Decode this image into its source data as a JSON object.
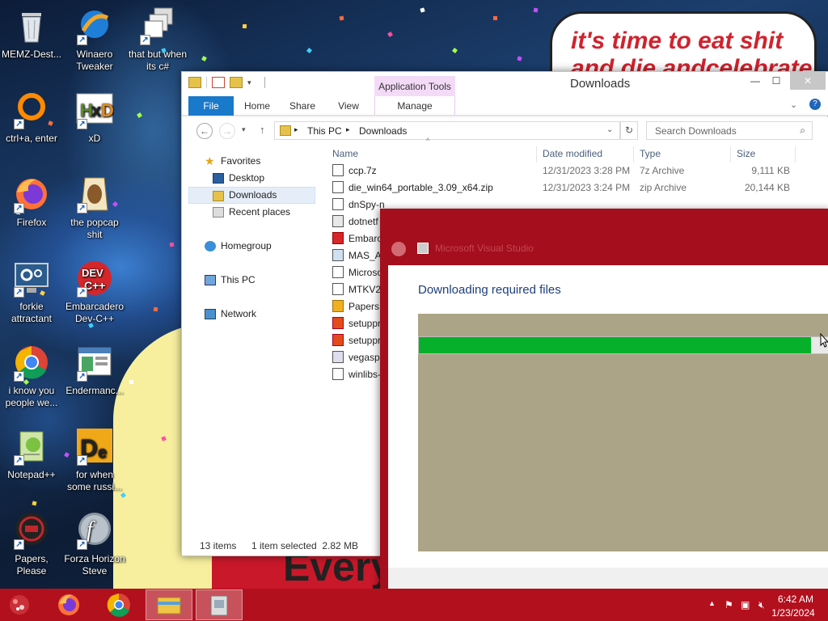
{
  "desktop": {
    "speech_bubble": {
      "line1": "it's time to eat shit",
      "line2": "and die andcelebrate"
    },
    "poster_text": "Every",
    "icons": [
      {
        "label": "MEMZ-Dest...",
        "icon": "recycle-bin-icon"
      },
      {
        "label": "Winaero Tweaker",
        "icon": "winaero-icon"
      },
      {
        "label": "that but when its c#",
        "icon": "stacked-windows-icon"
      },
      {
        "label": "ctrl+a, enter",
        "icon": "orange-ring-icon"
      },
      {
        "label": "xD",
        "icon": "hxd-icon"
      },
      {
        "label": "Firefox",
        "icon": "firefox-icon"
      },
      {
        "label": "the popcap shit",
        "icon": "popcap-icon"
      },
      {
        "label": "forkie attractant",
        "icon": "monitor-gear-icon"
      },
      {
        "label": "Embarcadero Dev-C++",
        "icon": "devcpp-icon"
      },
      {
        "label": "i know you people we...",
        "icon": "chrome-icon"
      },
      {
        "label": "Endermanc...",
        "icon": "window-app-icon"
      },
      {
        "label": "Notepad++",
        "icon": "notepadpp-icon"
      },
      {
        "label": "for when some russi...",
        "icon": "die-icon"
      },
      {
        "label": "Papers, Please",
        "icon": "papers-please-icon"
      },
      {
        "label": "Forza Horizon Steve",
        "icon": "flash-icon"
      }
    ]
  },
  "explorer": {
    "title": "Downloads",
    "contextual_tab": "Application Tools",
    "tabs": [
      "File",
      "Home",
      "Share",
      "View",
      "Manage"
    ],
    "address": {
      "root": "This PC",
      "current": "Downloads"
    },
    "search_placeholder": "Search Downloads",
    "nav": {
      "favorites": "Favorites",
      "desktop": "Desktop",
      "downloads": "Downloads",
      "recent": "Recent places",
      "homegroup": "Homegroup",
      "this_pc": "This PC",
      "network": "Network"
    },
    "columns": {
      "name": "Name",
      "date": "Date modified",
      "type": "Type",
      "size": "Size"
    },
    "files": [
      {
        "name": "ccp.7z",
        "date": "12/31/2023 3:28 PM",
        "type": "7z Archive",
        "size": "9,111 KB"
      },
      {
        "name": "die_win64_portable_3.09_x64.zip",
        "date": "12/31/2023 3:24 PM",
        "type": "zip Archive",
        "size": "20,144 KB"
      },
      {
        "name": "dnSpy-n",
        "date": "",
        "type": "",
        "size": ""
      },
      {
        "name": "dotnetf",
        "date": "",
        "type": "",
        "size": ""
      },
      {
        "name": "Embarc",
        "date": "",
        "type": "",
        "size": ""
      },
      {
        "name": "MAS_AI",
        "date": "",
        "type": "",
        "size": ""
      },
      {
        "name": "Microso",
        "date": "",
        "type": "",
        "size": ""
      },
      {
        "name": "MTKV2",
        "date": "",
        "type": "",
        "size": ""
      },
      {
        "name": "PapersP",
        "date": "",
        "type": "",
        "size": ""
      },
      {
        "name": "setuppr",
        "date": "",
        "type": "",
        "size": ""
      },
      {
        "name": "setuppr",
        "date": "",
        "type": "",
        "size": ""
      },
      {
        "name": "vegaspr",
        "date": "",
        "type": "",
        "size": ""
      },
      {
        "name": "winlibs-",
        "date": "",
        "type": "",
        "size": ""
      }
    ],
    "status": {
      "count": "13 items",
      "selection": "1 item selected  2.82 MB"
    }
  },
  "installer": {
    "title": "Microsoft Visual Studio",
    "heading": "Downloading required files",
    "progress": 0.95
  },
  "taskbar": {
    "time": "6:42 AM",
    "date": "1/23/2024",
    "buttons": [
      "start-button",
      "firefox-taskbar",
      "chrome-taskbar",
      "explorer-taskbar",
      "installer-taskbar"
    ]
  },
  "colors": {
    "accent": "#1979ca",
    "taskbar": "#b3101e",
    "dialog_frame": "#a50e1c",
    "progress": "#06b02a"
  }
}
